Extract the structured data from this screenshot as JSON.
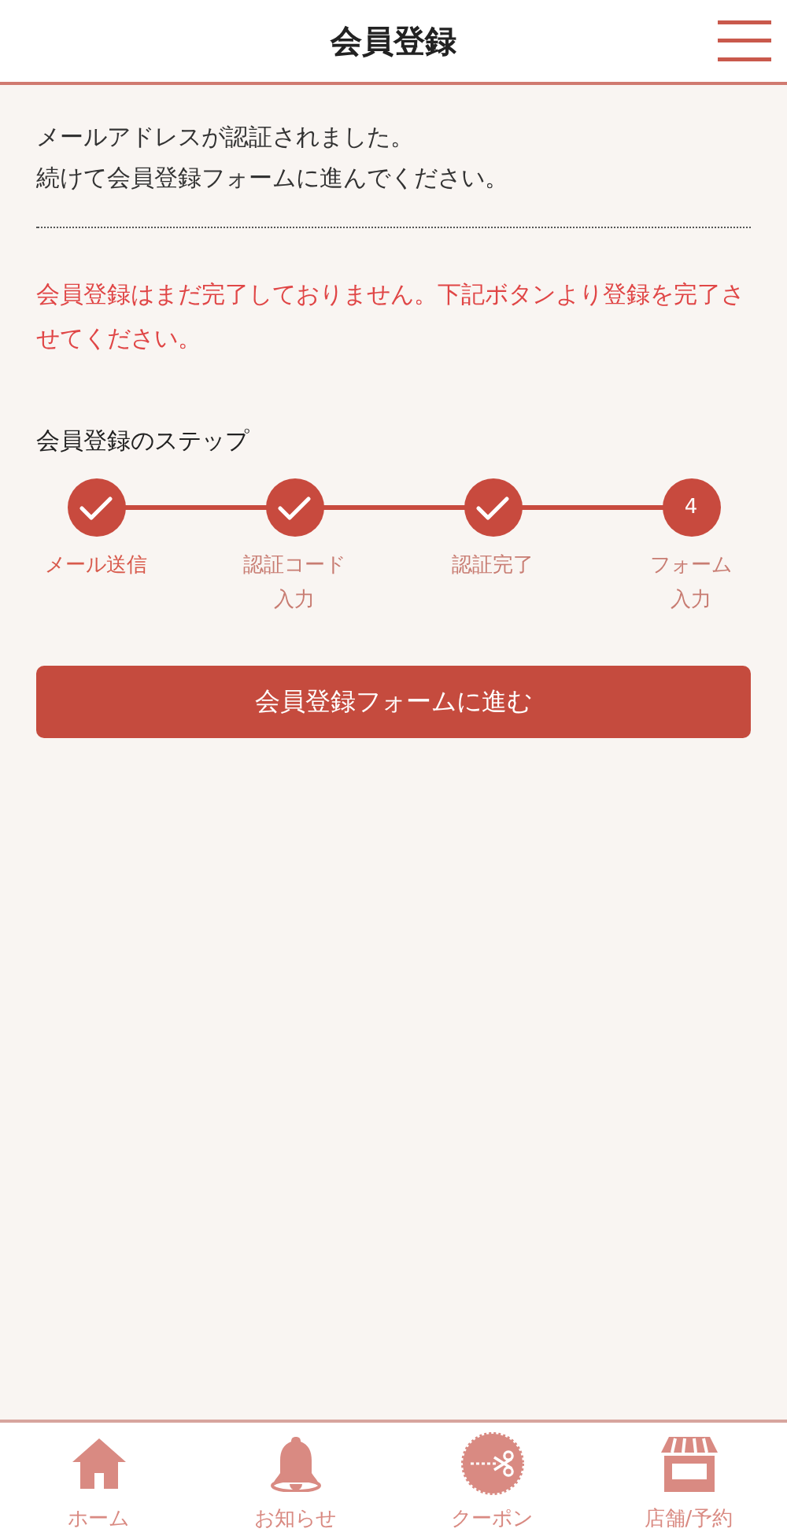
{
  "header": {
    "title": "会員登録"
  },
  "message": [
    "メールアドレスが認証されました。",
    "続けて会員登録フォームに進んでください。"
  ],
  "notice": "会員登録はまだ完了しておりません。下記ボタンより登録を完了させてください。",
  "steps_title": "会員登録のステップ",
  "steps": [
    {
      "label": [
        "メール送信"
      ],
      "done": true,
      "selected": true
    },
    {
      "label": [
        "認証コード",
        "入力"
      ],
      "done": true,
      "selected": false
    },
    {
      "label": [
        "認証完了"
      ],
      "done": true,
      "selected": false
    },
    {
      "label": [
        "フォーム",
        "入力"
      ],
      "done": false,
      "number": "4",
      "selected": false
    }
  ],
  "button": "会員登録フォームに進む",
  "tab_bar": [
    {
      "kind": "home",
      "label": "ホーム"
    },
    {
      "kind": "bell",
      "label": "お知らせ"
    },
    {
      "kind": "coupon",
      "label": "クーポン"
    },
    {
      "kind": "shop",
      "label": "店舗/予約"
    }
  ]
}
